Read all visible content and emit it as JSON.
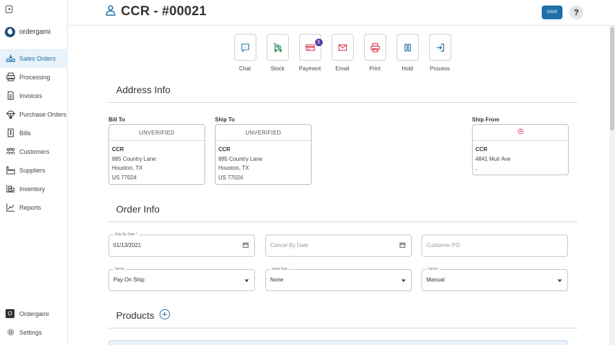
{
  "app": {
    "brand": "ordergami"
  },
  "sidebar": {
    "collapse_glyph": "◂",
    "items": [
      {
        "label": "Sales Orders",
        "icon": "inbox-download-icon",
        "active": true
      },
      {
        "label": "Processing",
        "icon": "printer-icon"
      },
      {
        "label": "Invoices",
        "icon": "document-icon"
      },
      {
        "label": "Purchase Orders",
        "icon": "parachute-icon"
      },
      {
        "label": "Bills",
        "icon": "receipt-icon"
      },
      {
        "label": "Customers",
        "icon": "users-icon"
      },
      {
        "label": "Suppliers",
        "icon": "factory-icon"
      },
      {
        "label": "Inventory",
        "icon": "boxes-icon"
      },
      {
        "label": "Reports",
        "icon": "line-chart-icon"
      }
    ],
    "org": {
      "badge": "O",
      "label": "Ordergami"
    },
    "settings": {
      "label": "Settings"
    }
  },
  "header": {
    "title": "CCR - #00021",
    "save_label": "SAVE",
    "help_label": "?"
  },
  "actions": [
    {
      "label": "Chat",
      "icon": "chat-icon"
    },
    {
      "label": "Stock",
      "icon": "stock-cart-icon"
    },
    {
      "label": "Payment",
      "icon": "credit-card-icon",
      "badge": "3"
    },
    {
      "label": "Email",
      "icon": "envelope-icon"
    },
    {
      "label": "Print",
      "icon": "printer-icon"
    },
    {
      "label": "Hold",
      "icon": "pause-icon"
    },
    {
      "label": "Process",
      "icon": "sign-in-icon"
    }
  ],
  "address": {
    "section_title": "Address Info",
    "bill_to": {
      "label": "Bill To",
      "status": "UNVERIFIED",
      "name": "CCR",
      "line1": "885 Country Lane",
      "line2": "Houston, TX",
      "line3": "US 77024"
    },
    "ship_to": {
      "label": "Ship To",
      "status": "UNVERIFIED",
      "name": "CCR",
      "line1": "885 Country Lane",
      "line2": "Houston, TX",
      "line3": "US 77024"
    },
    "ship_from": {
      "label": "Ship From",
      "name": "CCR",
      "line1": "4841 Muir Ave",
      "line2": ","
    }
  },
  "order": {
    "section_title": "Order Info",
    "ship_by": {
      "label": "Ship By Date *",
      "value": "01/13/2021"
    },
    "cancel_by": {
      "placeholder": "Cancel By Date"
    },
    "customer_po": {
      "placeholder": "Customer PO"
    },
    "terms": {
      "label": "Terms",
      "value": "Pay On Ship"
    },
    "sales_rep": {
      "label": "Sales Rep",
      "value": "None"
    },
    "carrier": {
      "label": "Carrier",
      "value": "Manual"
    }
  },
  "products": {
    "section_title": "Products"
  },
  "colors": {
    "accent": "#1f6fa8",
    "badge": "#5b3ca6",
    "email": "#d8435a",
    "print": "#d8435a",
    "hold": "#1f6fa8"
  }
}
